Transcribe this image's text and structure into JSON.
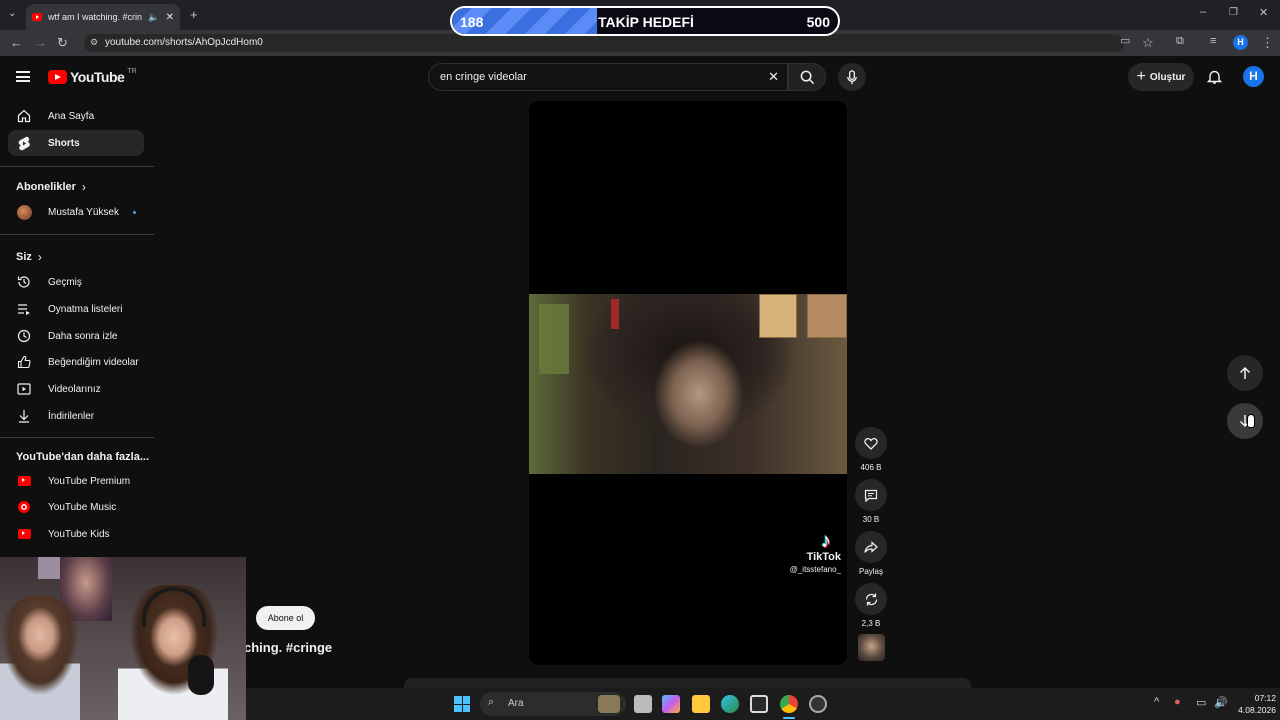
{
  "browser": {
    "tab_title": "wtf am I watching. #cringe",
    "url": "youtube.com/shorts/AhOpJcdHom0",
    "profile_initial": "H"
  },
  "overlay": {
    "follow_goal_current": "188",
    "follow_goal_title": "TAKİP HEDEFİ",
    "follow_goal_max": "500",
    "progress_fraction": 0.376
  },
  "masthead": {
    "logo_text": "YouTube",
    "region": "TR",
    "search_value": "en cringe videolar",
    "create_label": "Oluştur",
    "avatar_initial": "H"
  },
  "sidebar": {
    "home": "Ana Sayfa",
    "shorts": "Shorts",
    "subscriptions_heading": "Abonelikler",
    "subscription_channel": "Mustafa Yüksek",
    "you_heading": "Siz",
    "history": "Geçmiş",
    "playlists": "Oynatma listeleri",
    "watch_later": "Daha sonra izle",
    "liked": "Beğendiğim videolar",
    "your_videos": "Videolarınız",
    "downloads": "İndirilenler",
    "more_heading": "YouTube'dan daha fazla...",
    "premium": "YouTube Premium",
    "music": "YouTube Music",
    "kids": "YouTube Kids"
  },
  "short": {
    "tiktok_label": "TikTok",
    "tiktok_user": "@_itsstefano_",
    "subscribe_label": "Abone ol",
    "title_fragment": "ching. #cringe",
    "likes": "406 B",
    "comments": "30 B",
    "share": "Paylaş",
    "remix": "2,3 B"
  },
  "taskbar": {
    "search_placeholder": "Ara",
    "time": "07:12",
    "date": "4.08.2026"
  },
  "colors": {
    "youtube_red": "#ff0000",
    "goal_blue": "#3a6fe0",
    "avatar_blue": "#1a73e8"
  }
}
